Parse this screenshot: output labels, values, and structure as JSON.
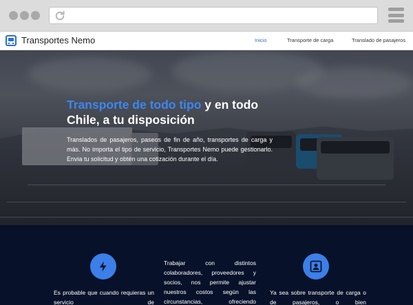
{
  "browser": {
    "url": "",
    "icons": {
      "reload": "reload-icon",
      "menu": "hamburger-menu-icon"
    }
  },
  "nav": {
    "brand": "Transportes Nemo",
    "links": [
      {
        "label": "Inicio",
        "active": true
      },
      {
        "label": "Transporte de carga",
        "active": false
      },
      {
        "label": "Translado de pasajeros",
        "active": false
      }
    ],
    "accent_color": "#2b6fd6"
  },
  "hero": {
    "title_accent": "Transporte de todo tipo",
    "title_rest": " y en todo Chile, a tu disposición",
    "text": "Translados de pasajeros, paseos de fin de año, transportes de carga y más. No importa el tipo de servicio, Transportes Nemo puede gestionarlo. Envia tu solicitud y obtén una cotización durante el día.",
    "accent_color": "#3d86f0"
  },
  "features": {
    "background": "#07112a",
    "items": [
      {
        "icon": "lightning-bolt-icon",
        "text": "Es probable que cuando requieras un servicio de"
      },
      {
        "text": "Trabajar con distintos colaboradores, proveedores y socios, nos permite ajustar nuestros costos según las circunstancias, ofreciendo"
      },
      {
        "icon": "person-badge-icon",
        "text": "Ya sea sobre transporte de carga o de pasajeros, o bien"
      }
    ]
  }
}
